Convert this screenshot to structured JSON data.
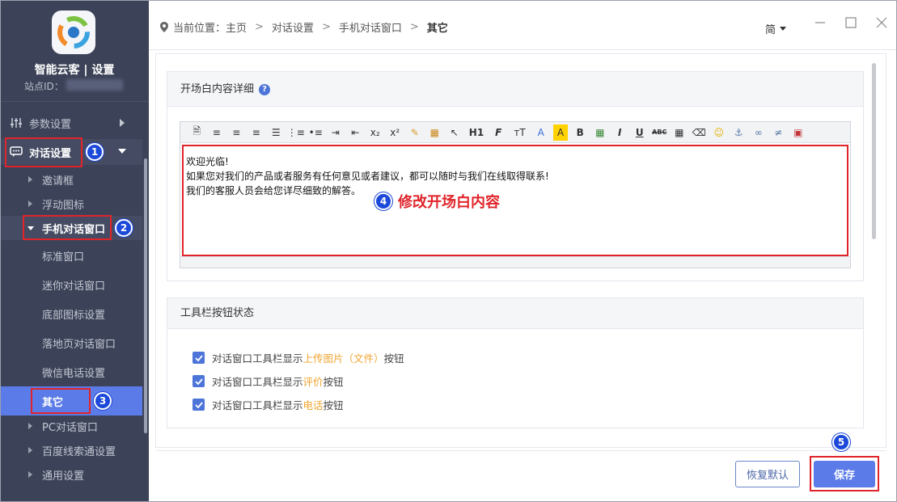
{
  "sidebar": {
    "app_title": "智能云客 | 设置",
    "site_id_label": "站点ID：",
    "items": [
      {
        "label": "参数设置"
      },
      {
        "label": "对话设置"
      },
      {
        "label": "邀请框"
      },
      {
        "label": "浮动图标"
      },
      {
        "label": "手机对话窗口"
      },
      {
        "label": "标准窗口"
      },
      {
        "label": "迷你对话窗口"
      },
      {
        "label": "底部图标设置"
      },
      {
        "label": "落地页对话窗口"
      },
      {
        "label": "微信电话设置"
      },
      {
        "label": "其它"
      },
      {
        "label": "PC对话窗口"
      },
      {
        "label": "百度线索通设置"
      },
      {
        "label": "通用设置"
      }
    ]
  },
  "badges": [
    "1",
    "2",
    "3",
    "4",
    "5"
  ],
  "topbar": {
    "breadcrumb": [
      "当前位置：主页",
      "对话设置",
      "手机对话窗口",
      "其它"
    ],
    "lang": "简"
  },
  "opening": {
    "title": "开场白内容详细",
    "help": "?",
    "lines": [
      "欢迎光临!",
      "如果您对我们的产品或者服务有任何意见或者建议，都可以随时与我们在线取得联系!",
      "我们的客服人员会给您详尽细致的解答。"
    ],
    "annotation": "修改开场白内容"
  },
  "toolbar_labels": {
    "h1": "H1",
    "font": "F",
    "size": "тT",
    "font_color": "A",
    "bg_color": "A",
    "bold": "B",
    "italic": "I",
    "underline": "U",
    "strike": "ABC"
  },
  "toolbar_state": {
    "title": "工具栏按钮状态",
    "items": [
      {
        "prefix": "对话窗口工具栏显示",
        "highlight": "上传图片（文件）",
        "suffix": "按钮",
        "checked": true
      },
      {
        "prefix": "对话窗口工具栏显示",
        "highlight": "评价",
        "suffix": "按钮",
        "checked": true
      },
      {
        "prefix": "对话窗口工具栏显示",
        "highlight": "电话",
        "suffix": "按钮",
        "checked": true
      }
    ]
  },
  "footer": {
    "reset_label": "恢复默认",
    "save_label": "保存"
  },
  "colors": {
    "sidebar_bg": "#3c4358",
    "accent": "#5b7ce8",
    "annotation_red": "#e0242a",
    "badge_blue": "#1c49d9",
    "highlight": "#f0a530"
  }
}
